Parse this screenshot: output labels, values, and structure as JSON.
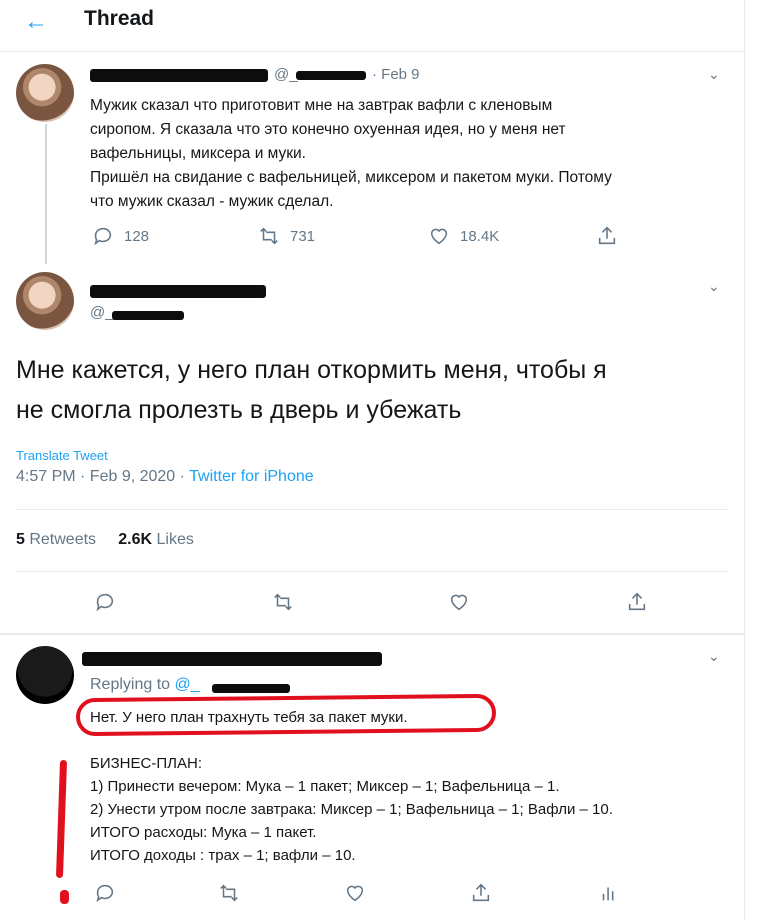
{
  "header": {
    "back_icon": "arrow-left-icon",
    "title": "Thread"
  },
  "tweet1": {
    "handle_prefix": "@_",
    "date": "· Feb 9",
    "text": "Мужик сказал что приготовит мне на завтрак вафли с кленовым\nсиропом. Я сказала что это конечно охуенная идея, но у меня нет\nвафельницы, миксера и муки.\nПришёл на свидание с вафельницей, миксером и пакетом муки. Потому\nчто мужик сказал - мужик сделал.",
    "replies": "128",
    "retweets": "731",
    "likes": "18.4K"
  },
  "tweet2": {
    "handle_prefix": "@_",
    "text": "Мне кажется, у него план откормить меня, чтобы я\nне смогла пролезть в дверь и убежать",
    "translate": "Translate Tweet",
    "time": "4:57 PM · Feb 9, 2020 · ",
    "source": "Twitter for iPhone",
    "retweets_count": "5",
    "retweets_label": " Retweets",
    "likes_count": "2.6K",
    "likes_label": " Likes"
  },
  "tweet3": {
    "replying_to": "Replying to ",
    "replying_handle": "@_",
    "text": "Нет. У него план трахнуть тебя за пакет муки.\n\nБИЗНЕС-ПЛАН:\n1) Принести вечером: Мука – 1 пакет; Миксер – 1; Вафельница – 1.\n2) Унести утром после завтрака: Миксер – 1; Вафельница – 1; Вафли – 10.\nИТОГО расходы: Мука – 1 пакет.\nИТОГО доходы : трах – 1; вафли – 10."
  },
  "colors": {
    "accent": "#1da1f2",
    "secondary": "#657786",
    "annotation": "#e0101f"
  }
}
